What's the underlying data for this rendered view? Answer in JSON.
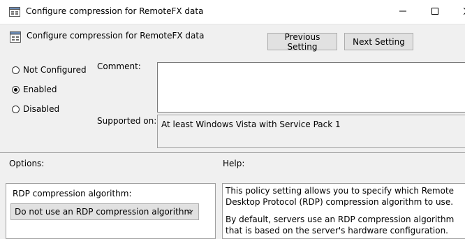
{
  "window": {
    "title": "Configure compression for RemoteFX data",
    "icon": "policy-setting-icon",
    "controls": [
      "minimize-icon",
      "maximize-icon",
      "close-icon"
    ]
  },
  "header": {
    "title": "Configure compression for RemoteFX data",
    "previous_label": "Previous Setting",
    "next_label": "Next Setting"
  },
  "state": {
    "options": [
      {
        "label": "Not Configured",
        "checked": false
      },
      {
        "label": "Enabled",
        "checked": true
      },
      {
        "label": "Disabled",
        "checked": false
      }
    ]
  },
  "comment": {
    "label": "Comment:",
    "value": ""
  },
  "supported": {
    "label": "Supported on:",
    "value": "At least Windows Vista with Service Pack 1"
  },
  "options_section": {
    "label": "Options:",
    "field_label": "RDP compression algorithm:",
    "selected": "Do not use an RDP compression algorithm"
  },
  "help_section": {
    "label": "Help:",
    "paragraphs": [
      "This policy setting allows you to specify which Remote Desktop Protocol (RDP) compression algorithm to use.",
      "By default, servers use an RDP compression algorithm that is based on the server's hardware configuration."
    ]
  }
}
